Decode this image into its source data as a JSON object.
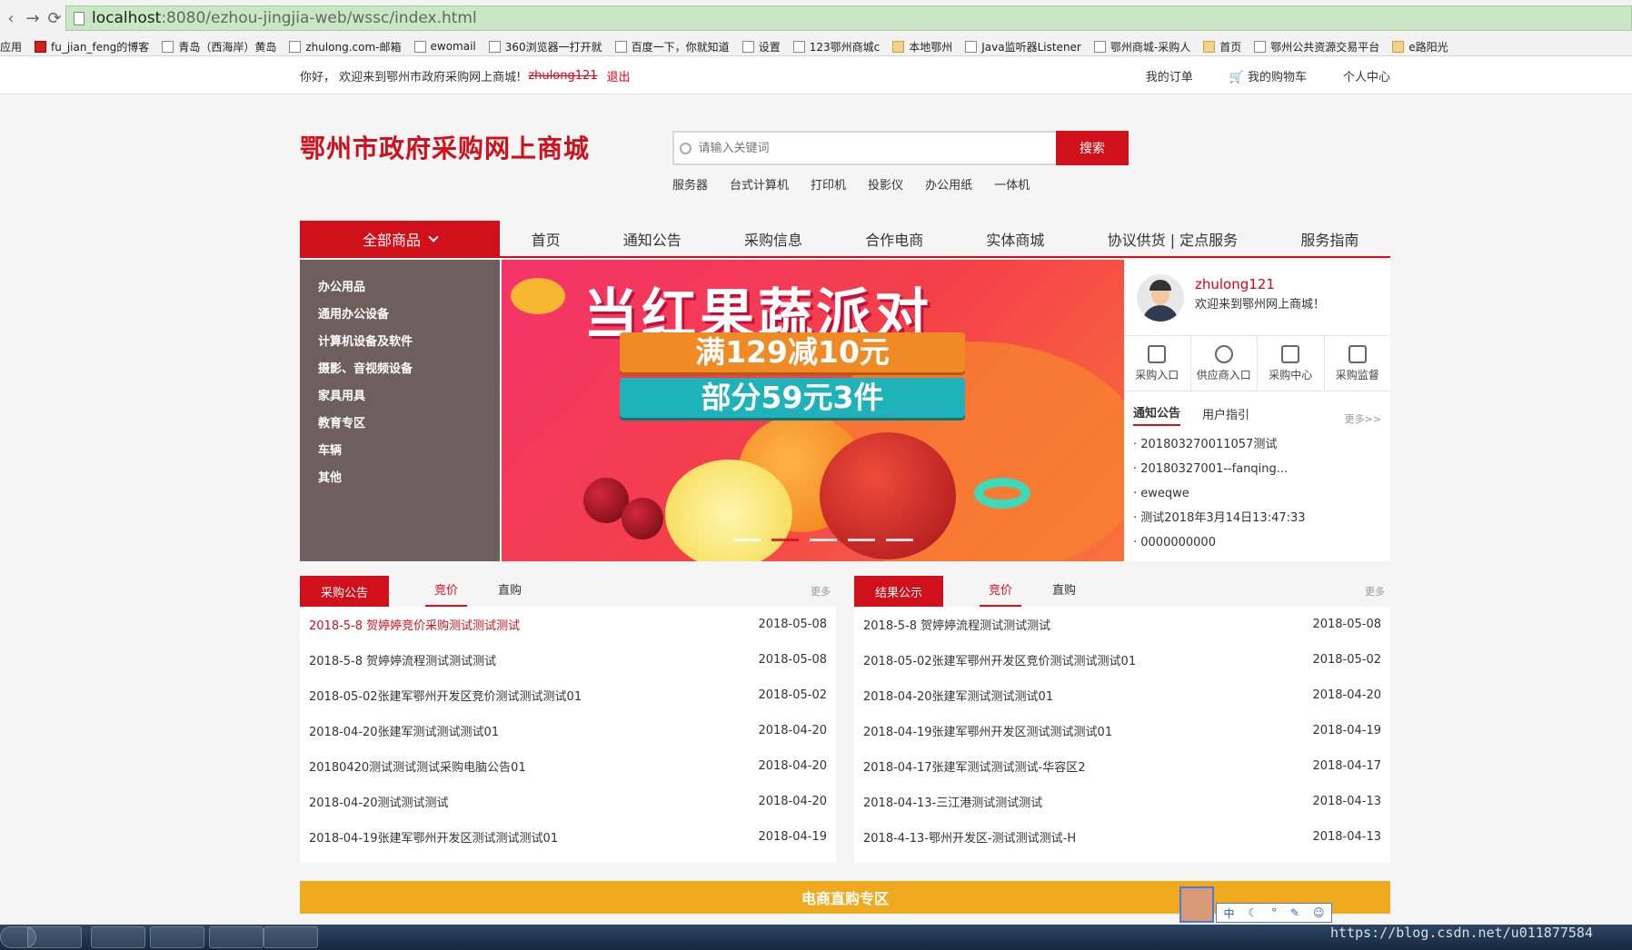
{
  "browser": {
    "url_host": "localhost",
    "url_path": ":8080/ezhou-jingjia-web/wssc/index.html",
    "bookmarks": [
      "应用",
      "fu_jian_feng的博客",
      "青岛（西海岸）黄岛",
      "zhulong.com-邮箱",
      "ewomail",
      "360浏览器一打开就",
      "百度一下，你就知道",
      "设置",
      "123鄂州商城c",
      "本地鄂州",
      "Java监听器Listener",
      "鄂州商城-采购人",
      "首页",
      "鄂州公共资源交易平台",
      "e路阳光"
    ]
  },
  "topbar": {
    "welcome": "你好， 欢迎来到鄂州市政府采购网上商城!",
    "username": "zhulong121",
    "logout": "退出",
    "links": [
      "我的订单",
      "我的购物车",
      "个人中心"
    ]
  },
  "header": {
    "logo": "鄂州市政府采购网上商城",
    "search_placeholder": "请输入关键词",
    "search_button": "搜索",
    "hot_keywords": [
      "服务器",
      "台式计算机",
      "打印机",
      "投影仪",
      "办公用纸",
      "一体机"
    ]
  },
  "nav": {
    "all_goods": "全部商品",
    "items": [
      "首页",
      "通知公告",
      "采购信息",
      "合作电商",
      "实体商城",
      "协议供货 | 定点服务",
      "服务指南"
    ]
  },
  "categories": [
    "办公用品",
    "通用办公设备",
    "计算机设备及软件",
    "摄影、音视频设备",
    "家具用具",
    "教育专区",
    "车辆",
    "其他"
  ],
  "banner": {
    "title": "当红果蔬派对",
    "ribbon1": "满129减10元",
    "ribbon2": "部分59元3件",
    "active_slide": 2,
    "slide_count": 5
  },
  "user_panel": {
    "name": "zhulong121",
    "greeting": "欢迎来到鄂州网上商城！",
    "entries": [
      "采购入口",
      "供应商入口",
      "采购中心",
      "采购监督"
    ],
    "tabs": [
      "通知公告",
      "用户指引"
    ],
    "more": "更多>>",
    "notices": [
      "· 201803270011057测试",
      "· 20180327001--fanqing...",
      "· eweqwe",
      "· 测试2018年3月14日13:47:33",
      "· 0000000000"
    ]
  },
  "procurement": {
    "title": "采购公告",
    "tabs": [
      "竞价",
      "直购"
    ],
    "more": "更多",
    "rows": [
      {
        "title": "2018-5-8 贺婷婷竞价采购测试测试测试",
        "date": "2018-05-08"
      },
      {
        "title": "2018-5-8 贺婷婷流程测试测试测试",
        "date": "2018-05-08"
      },
      {
        "title": "2018-05-02张建军鄂州开发区竞价测试测试测试01",
        "date": "2018-05-02"
      },
      {
        "title": "2018-04-20张建军测试测试测试01",
        "date": "2018-04-20"
      },
      {
        "title": "20180420测试测试测试采购电脑公告01",
        "date": "2018-04-20"
      },
      {
        "title": "2018-04-20测试测试测试",
        "date": "2018-04-20"
      },
      {
        "title": "2018-04-19张建军鄂州开发区测试测试测试01",
        "date": "2018-04-19"
      }
    ]
  },
  "results": {
    "title": "结果公示",
    "tabs": [
      "竞价",
      "直购"
    ],
    "more": "更多",
    "rows": [
      {
        "title": "2018-5-8 贺婷婷流程测试测试测试",
        "date": "2018-05-08"
      },
      {
        "title": "2018-05-02张建军鄂州开发区竞价测试测试测试01",
        "date": "2018-05-02"
      },
      {
        "title": "2018-04-20张建军测试测试测试01",
        "date": "2018-04-20"
      },
      {
        "title": "2018-04-19张建军鄂州开发区测试测试测试01",
        "date": "2018-04-19"
      },
      {
        "title": "2018-04-17张建军测试测试测试-华容区2",
        "date": "2018-04-17"
      },
      {
        "title": "2018-04-13-三江港测试测试测试",
        "date": "2018-04-13"
      },
      {
        "title": "2018-4-13-鄂州开发区-测试测试测试-H",
        "date": "2018-04-13"
      }
    ]
  },
  "strip": {
    "label": "电商直购专区"
  },
  "ime": {
    "label": "中"
  },
  "watermark": "https://blog.csdn.net/u011877584",
  "colors": {
    "brand_red": "#d0101b",
    "category_bg": "#6e5f5c",
    "strip_yellow": "#f0aa1f"
  }
}
